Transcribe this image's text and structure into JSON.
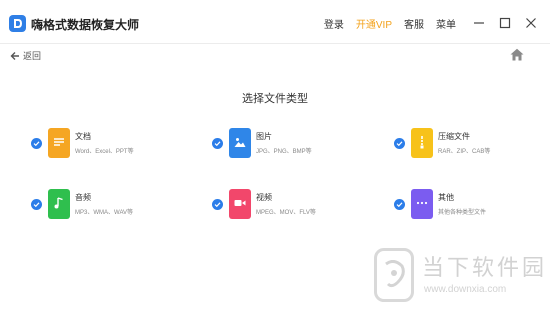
{
  "app": {
    "title": "嗨格式数据恢复大师"
  },
  "header": {
    "login": "登录",
    "vip": "开通VIP",
    "service": "客服",
    "menu": "菜单"
  },
  "nav": {
    "back_label": "返回"
  },
  "main": {
    "title": "选择文件类型",
    "types": [
      {
        "name": "文档",
        "desc": "Word、Excel、PPT等",
        "color": "#f5a623",
        "icon": "document-icon"
      },
      {
        "name": "图片",
        "desc": "JPG、PNG、BMP等",
        "color": "#2f86e8",
        "icon": "image-icon"
      },
      {
        "name": "压缩文件",
        "desc": "RAR、ZIP、CAB等",
        "color": "#f7c21a",
        "icon": "archive-icon"
      },
      {
        "name": "音频",
        "desc": "MP3、WMA、WAV等",
        "color": "#2fbf4e",
        "icon": "music-note-icon"
      },
      {
        "name": "视频",
        "desc": "MPEG、MOV、FLV等",
        "color": "#f2476b",
        "icon": "video-camera-icon"
      },
      {
        "name": "其他",
        "desc": "其他各种类型文件",
        "color": "#7b5cf0",
        "icon": "more-dots-icon"
      }
    ]
  },
  "watermark": {
    "text": "当下软件园",
    "url": "www.downxia.com"
  },
  "colors": {
    "accent": "#2b7de9",
    "vip": "#f3a21b"
  }
}
